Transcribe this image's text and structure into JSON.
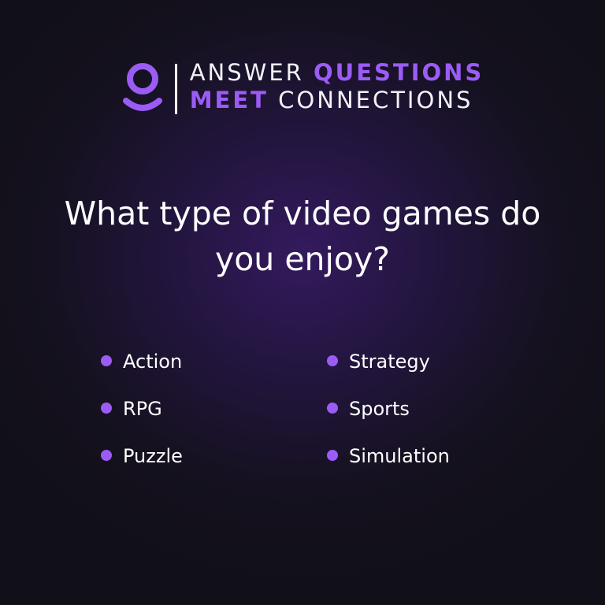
{
  "brand": {
    "line1_white": "ANSWER ",
    "line1_purple": "QUESTIONS",
    "line2_purple": "MEET",
    "line2_white": " CONNECTIONS",
    "logo_icon": "person-icon",
    "accent_color": "#9b5cf6"
  },
  "question": {
    "line1": "What type of video games do",
    "line2": "you enjoy?"
  },
  "options": [
    {
      "label": "Action"
    },
    {
      "label": "Strategy"
    },
    {
      "label": "RPG"
    },
    {
      "label": "Sports"
    },
    {
      "label": "Puzzle"
    },
    {
      "label": "Simulation"
    }
  ]
}
